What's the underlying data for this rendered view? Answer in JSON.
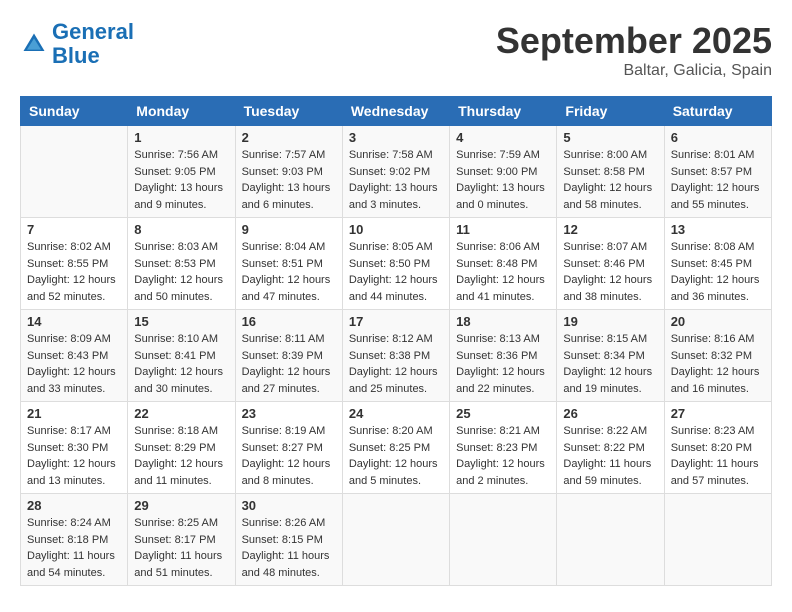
{
  "logo": {
    "text_general": "General",
    "text_blue": "Blue"
  },
  "title": "September 2025",
  "location": "Baltar, Galicia, Spain",
  "headers": [
    "Sunday",
    "Monday",
    "Tuesday",
    "Wednesday",
    "Thursday",
    "Friday",
    "Saturday"
  ],
  "weeks": [
    [
      {
        "day": "",
        "content": ""
      },
      {
        "day": "1",
        "content": "Sunrise: 7:56 AM\nSunset: 9:05 PM\nDaylight: 13 hours\nand 9 minutes."
      },
      {
        "day": "2",
        "content": "Sunrise: 7:57 AM\nSunset: 9:03 PM\nDaylight: 13 hours\nand 6 minutes."
      },
      {
        "day": "3",
        "content": "Sunrise: 7:58 AM\nSunset: 9:02 PM\nDaylight: 13 hours\nand 3 minutes."
      },
      {
        "day": "4",
        "content": "Sunrise: 7:59 AM\nSunset: 9:00 PM\nDaylight: 13 hours\nand 0 minutes."
      },
      {
        "day": "5",
        "content": "Sunrise: 8:00 AM\nSunset: 8:58 PM\nDaylight: 12 hours\nand 58 minutes."
      },
      {
        "day": "6",
        "content": "Sunrise: 8:01 AM\nSunset: 8:57 PM\nDaylight: 12 hours\nand 55 minutes."
      }
    ],
    [
      {
        "day": "7",
        "content": "Sunrise: 8:02 AM\nSunset: 8:55 PM\nDaylight: 12 hours\nand 52 minutes."
      },
      {
        "day": "8",
        "content": "Sunrise: 8:03 AM\nSunset: 8:53 PM\nDaylight: 12 hours\nand 50 minutes."
      },
      {
        "day": "9",
        "content": "Sunrise: 8:04 AM\nSunset: 8:51 PM\nDaylight: 12 hours\nand 47 minutes."
      },
      {
        "day": "10",
        "content": "Sunrise: 8:05 AM\nSunset: 8:50 PM\nDaylight: 12 hours\nand 44 minutes."
      },
      {
        "day": "11",
        "content": "Sunrise: 8:06 AM\nSunset: 8:48 PM\nDaylight: 12 hours\nand 41 minutes."
      },
      {
        "day": "12",
        "content": "Sunrise: 8:07 AM\nSunset: 8:46 PM\nDaylight: 12 hours\nand 38 minutes."
      },
      {
        "day": "13",
        "content": "Sunrise: 8:08 AM\nSunset: 8:45 PM\nDaylight: 12 hours\nand 36 minutes."
      }
    ],
    [
      {
        "day": "14",
        "content": "Sunrise: 8:09 AM\nSunset: 8:43 PM\nDaylight: 12 hours\nand 33 minutes."
      },
      {
        "day": "15",
        "content": "Sunrise: 8:10 AM\nSunset: 8:41 PM\nDaylight: 12 hours\nand 30 minutes."
      },
      {
        "day": "16",
        "content": "Sunrise: 8:11 AM\nSunset: 8:39 PM\nDaylight: 12 hours\nand 27 minutes."
      },
      {
        "day": "17",
        "content": "Sunrise: 8:12 AM\nSunset: 8:38 PM\nDaylight: 12 hours\nand 25 minutes."
      },
      {
        "day": "18",
        "content": "Sunrise: 8:13 AM\nSunset: 8:36 PM\nDaylight: 12 hours\nand 22 minutes."
      },
      {
        "day": "19",
        "content": "Sunrise: 8:15 AM\nSunset: 8:34 PM\nDaylight: 12 hours\nand 19 minutes."
      },
      {
        "day": "20",
        "content": "Sunrise: 8:16 AM\nSunset: 8:32 PM\nDaylight: 12 hours\nand 16 minutes."
      }
    ],
    [
      {
        "day": "21",
        "content": "Sunrise: 8:17 AM\nSunset: 8:30 PM\nDaylight: 12 hours\nand 13 minutes."
      },
      {
        "day": "22",
        "content": "Sunrise: 8:18 AM\nSunset: 8:29 PM\nDaylight: 12 hours\nand 11 minutes."
      },
      {
        "day": "23",
        "content": "Sunrise: 8:19 AM\nSunset: 8:27 PM\nDaylight: 12 hours\nand 8 minutes."
      },
      {
        "day": "24",
        "content": "Sunrise: 8:20 AM\nSunset: 8:25 PM\nDaylight: 12 hours\nand 5 minutes."
      },
      {
        "day": "25",
        "content": "Sunrise: 8:21 AM\nSunset: 8:23 PM\nDaylight: 12 hours\nand 2 minutes."
      },
      {
        "day": "26",
        "content": "Sunrise: 8:22 AM\nSunset: 8:22 PM\nDaylight: 11 hours\nand 59 minutes."
      },
      {
        "day": "27",
        "content": "Sunrise: 8:23 AM\nSunset: 8:20 PM\nDaylight: 11 hours\nand 57 minutes."
      }
    ],
    [
      {
        "day": "28",
        "content": "Sunrise: 8:24 AM\nSunset: 8:18 PM\nDaylight: 11 hours\nand 54 minutes."
      },
      {
        "day": "29",
        "content": "Sunrise: 8:25 AM\nSunset: 8:17 PM\nDaylight: 11 hours\nand 51 minutes."
      },
      {
        "day": "30",
        "content": "Sunrise: 8:26 AM\nSunset: 8:15 PM\nDaylight: 11 hours\nand 48 minutes."
      },
      {
        "day": "",
        "content": ""
      },
      {
        "day": "",
        "content": ""
      },
      {
        "day": "",
        "content": ""
      },
      {
        "day": "",
        "content": ""
      }
    ]
  ]
}
